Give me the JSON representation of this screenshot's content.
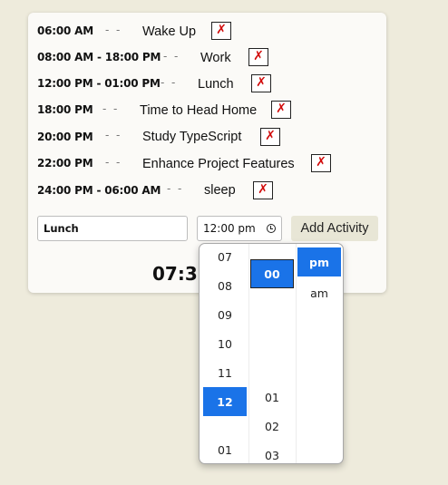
{
  "schedule": [
    {
      "time": "06:00 AM",
      "sep": "- -",
      "task": "Wake Up",
      "delete": "✗"
    },
    {
      "time": "08:00 AM - 18:00 PM",
      "sep": "- -",
      "task": "Work",
      "delete": "✗"
    },
    {
      "time": "12:00 PM - 01:00 PM",
      "sep": "- -",
      "task": "Lunch",
      "delete": "✗"
    },
    {
      "time": "18:00 PM",
      "sep": "- -",
      "task": "Time to Head Home",
      "delete": "✗"
    },
    {
      "time": "20:00 PM",
      "sep": "- -",
      "task": "Study TypeScript",
      "delete": "✗"
    },
    {
      "time": "22:00 PM",
      "sep": "- -",
      "task": "Enhance Project Features",
      "delete": "✗"
    },
    {
      "time": "24:00 PM - 06:00 AM",
      "sep": "- -",
      "task": "sleep",
      "delete": "✗"
    }
  ],
  "form": {
    "task_value": "Lunch",
    "time_value": "12:00 pm",
    "add_label": "Add Activity"
  },
  "clock": {
    "text": "07:35"
  },
  "picker": {
    "hours": [
      "07",
      "08",
      "09",
      "10",
      "11",
      "12",
      "01"
    ],
    "selected_hour": "12",
    "minutes": [
      "00",
      "01",
      "02",
      "03"
    ],
    "selected_minute": "00",
    "periods": [
      "pm",
      "am"
    ],
    "selected_period": "pm",
    "accent_color": "#1a73e8"
  },
  "colors": {
    "background": "#eeebdc",
    "card": "#fbfaf7",
    "delete_mark": "#d10a0a",
    "button": "#e8e6d6"
  }
}
